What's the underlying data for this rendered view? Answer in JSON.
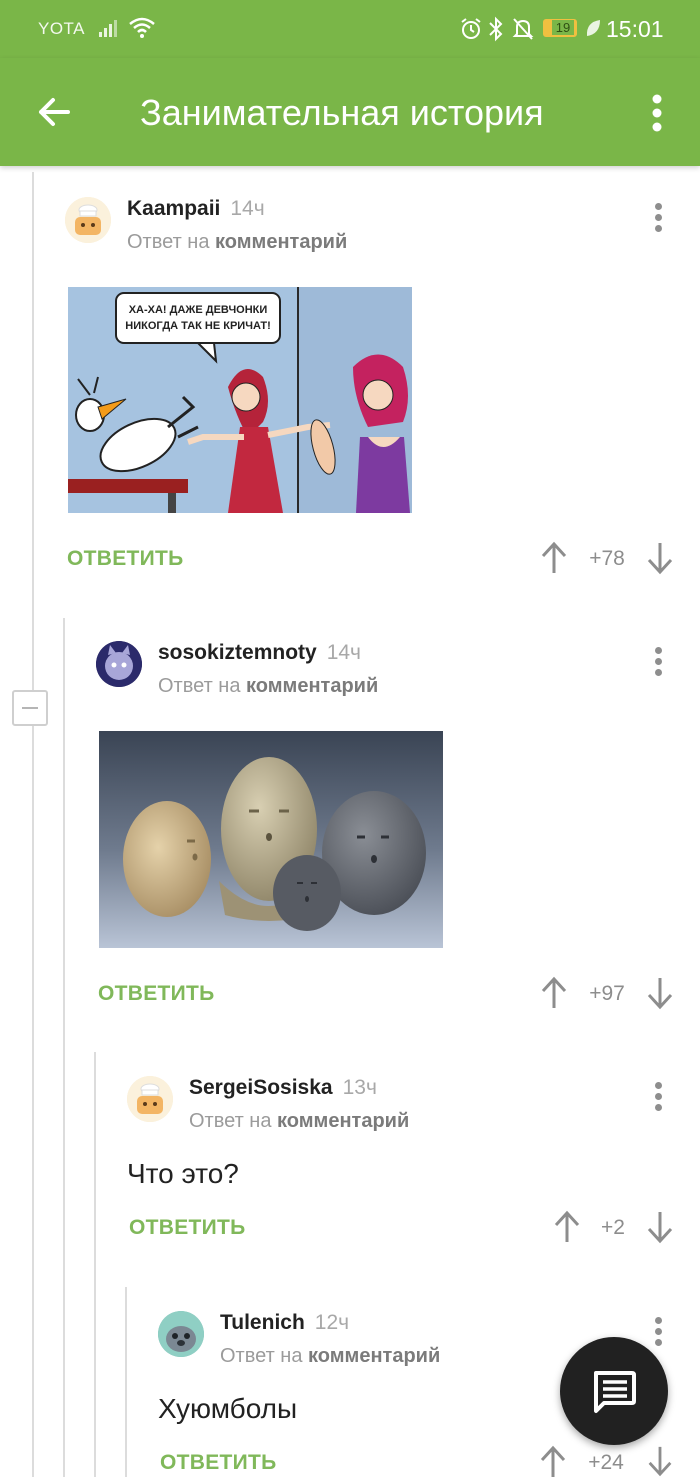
{
  "status_bar": {
    "carrier": "YOTA",
    "battery": "19",
    "time": "15:01"
  },
  "app_bar": {
    "title": "Занимательная история",
    "back_icon": "arrow-left-icon",
    "menu_icon": "more-vertical-icon"
  },
  "comments": [
    {
      "username": "Kaampaii",
      "time": "14ч",
      "reply_prefix": "Ответ на",
      "reply_target": "комментарий",
      "image": {
        "type": "comic",
        "speech_bubble": [
          "ХА-ХА! ДАЖЕ ДЕВЧОНКИ",
          "НИКОГДА ТАК НЕ КРИЧАТ!"
        ]
      },
      "reply_label": "ОТВЕТИТЬ",
      "score": "+78"
    },
    {
      "username": "sosokiztemnoty",
      "time": "14ч",
      "reply_prefix": "Ответ на",
      "reply_target": "комментарий",
      "image": {
        "type": "photo"
      },
      "reply_label": "ОТВЕТИТЬ",
      "score": "+97"
    },
    {
      "username": "SergeiSosiska",
      "time": "13ч",
      "reply_prefix": "Ответ на",
      "reply_target": "комментарий",
      "text": "Что это?",
      "reply_label": "ОТВЕТИТЬ",
      "score": "+2"
    },
    {
      "username": "Tulenich",
      "time": "12ч",
      "reply_prefix": "Ответ на",
      "reply_target": "комментарий",
      "text": "Хуюмболы",
      "reply_label": "ОТВЕТИТЬ",
      "score": "+24"
    }
  ],
  "fab": {
    "icon": "comment-icon"
  },
  "colors": {
    "brand": "#7ab648",
    "reply": "#80b85a",
    "fab": "#212121"
  }
}
